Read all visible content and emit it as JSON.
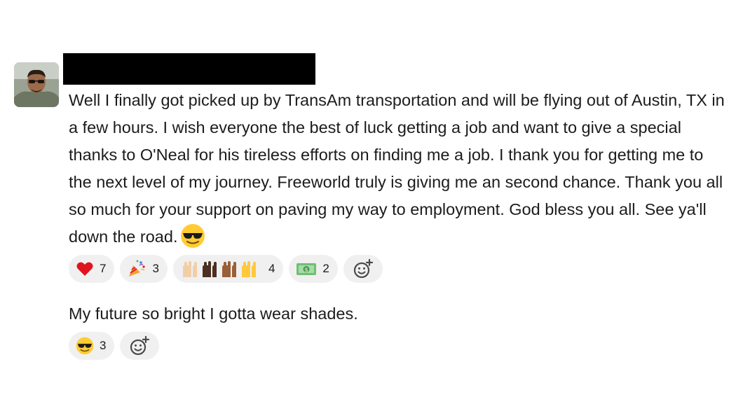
{
  "post": {
    "message": "Well I finally got picked up by  TransAm transportation and will be flying out of Austin, TX  in a few hours. I wish everyone the best of luck getting a job and want to give a special thanks to O'Neal for his tireless efforts on finding me a job. I thank you for getting me to the next level of my journey. Freeworld truly is giving me an second chance. Thank you all so much for your support on paving my way to employment. God bless you all. See ya'll down the road.",
    "message_emoji": "sunglasses-face",
    "reactions": [
      {
        "icon": "red-heart-icon",
        "count": "7"
      },
      {
        "icon": "party-popper-icon",
        "count": "3"
      },
      {
        "icon": "raised-hands-icon",
        "count": "4"
      },
      {
        "icon": "dollar-bill-icon",
        "count": "2"
      }
    ]
  },
  "reply": {
    "message": "My future so bright I gotta wear shades.",
    "reactions": [
      {
        "icon": "sunglasses-face-icon",
        "count": "3"
      }
    ]
  },
  "colors": {
    "text": "#1d1c1d",
    "pill_bg": "#f0f0f0",
    "redaction": "#000000",
    "heart": "#e0141e",
    "emoji_yellow": "#ffcc33"
  }
}
